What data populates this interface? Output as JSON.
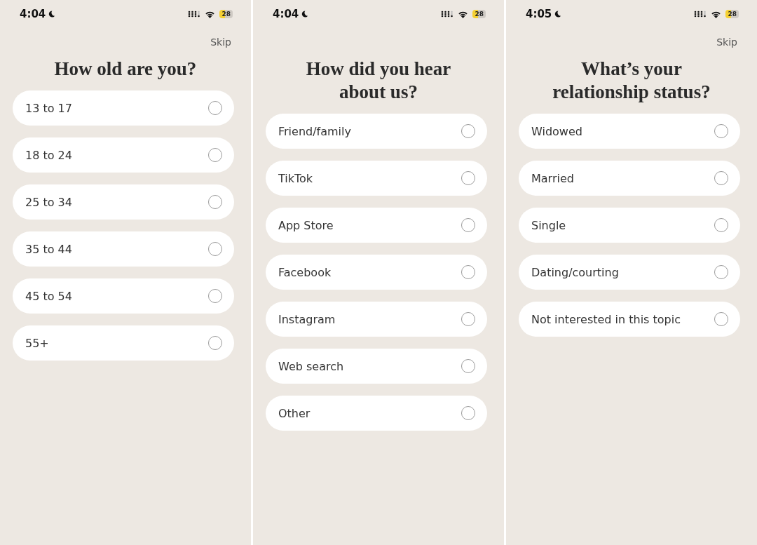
{
  "screens": [
    {
      "status_bar": {
        "time": "4:04",
        "battery": "28"
      },
      "skip": "Skip",
      "title": "How old are you?",
      "options": [
        {
          "label": "13 to 17",
          "selected": false
        },
        {
          "label": "18 to 24",
          "selected": false
        },
        {
          "label": "25 to 34",
          "selected": false
        },
        {
          "label": "35 to 44",
          "selected": false
        },
        {
          "label": "45 to 54",
          "selected": false
        },
        {
          "label": "55+",
          "selected": false
        }
      ]
    },
    {
      "status_bar": {
        "time": "4:04",
        "battery": "28"
      },
      "title": "How did you hear about us?",
      "options": [
        {
          "label": "Friend/family",
          "selected": false
        },
        {
          "label": "TikTok",
          "selected": false
        },
        {
          "label": "App Store",
          "selected": false
        },
        {
          "label": "Facebook",
          "selected": false
        },
        {
          "label": "Instagram",
          "selected": false
        },
        {
          "label": "Web search",
          "selected": false
        },
        {
          "label": "Other",
          "selected": false
        }
      ]
    },
    {
      "status_bar": {
        "time": "4:05",
        "battery": "28"
      },
      "skip": "Skip",
      "title": "What’s your relationship status?",
      "options": [
        {
          "label": "Widowed",
          "selected": false
        },
        {
          "label": "Married",
          "selected": false
        },
        {
          "label": "Single",
          "selected": false
        },
        {
          "label": "Dating/courting",
          "selected": false
        },
        {
          "label": "Not interested in this topic",
          "selected": false
        }
      ]
    }
  ]
}
